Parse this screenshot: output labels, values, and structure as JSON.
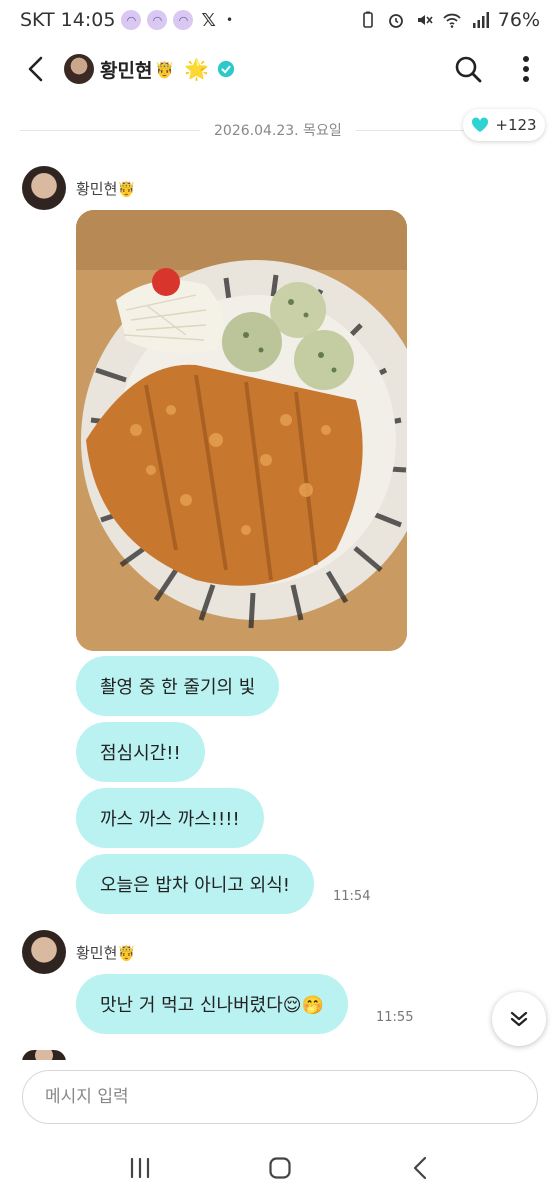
{
  "status_bar": {
    "carrier": "SKT",
    "time": "14:05",
    "x_label": "𝕏",
    "dot": "•",
    "battery": "76%"
  },
  "header": {
    "name": "황민현",
    "crown": "🤴",
    "sparkle": "🌟",
    "verified_color": "#2bc9c9"
  },
  "date_separator": "2026.04.23. 목요일",
  "hearts": {
    "count": "+123",
    "color": "#2fd3d3"
  },
  "messages": [
    {
      "sender": "황민현",
      "crown": "🤴",
      "bubbles": [
        "촬영 중 한 줄기의 빛",
        "점심시간!!",
        "까스 까스 까스!!!!",
        "오늘은 밥차 아니고 외식!"
      ],
      "time": "11:54"
    },
    {
      "sender": "황민현",
      "crown": "🤴",
      "bubbles": [
        "맛난 거 먹고 신나버렸다😌🤭"
      ],
      "time": "11:55"
    }
  ],
  "input": {
    "placeholder": "메시지 입력"
  },
  "colors": {
    "bubble": "#baf2f2",
    "accent": "#2bc9c9"
  }
}
